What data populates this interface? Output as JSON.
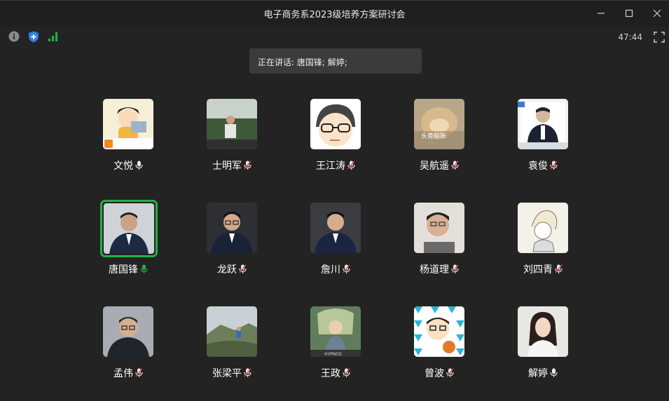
{
  "window": {
    "title": "电子商务系2023级培养方案研讨会",
    "controls": [
      "minimize-icon",
      "maximize-icon",
      "close-icon"
    ]
  },
  "toolbar": {
    "icons": [
      "info-icon",
      "security-shield-icon",
      "signal-strength-icon",
      "fullscreen-icon"
    ],
    "timer": "47:44"
  },
  "speaking_banner": "正在讲话: 唐国锋; 解婷;",
  "colors": {
    "background": "#232323",
    "active_border": "#22b14c",
    "mic_active": "#22b14c",
    "mic_muted": "#e03c3c"
  },
  "participants": [
    {
      "name": "文悦",
      "mic": "on",
      "avatar_caption": "自愿上班"
    },
    {
      "name": "士明军",
      "mic": "muted"
    },
    {
      "name": "王江涛",
      "mic": "muted"
    },
    {
      "name": "吴航遥",
      "mic": "muted",
      "avatar_caption": "头昏脑胀"
    },
    {
      "name": "袁俊",
      "mic": "muted"
    },
    {
      "name": "唐国锋",
      "mic": "speaking",
      "active": true
    },
    {
      "name": "龙跃",
      "mic": "muted"
    },
    {
      "name": "詹川",
      "mic": "muted"
    },
    {
      "name": "杨道理",
      "mic": "muted"
    },
    {
      "name": "刘四青",
      "mic": "muted"
    },
    {
      "name": "孟伟",
      "mic": "muted"
    },
    {
      "name": "张梁平",
      "mic": "muted"
    },
    {
      "name": "王政",
      "mic": "muted"
    },
    {
      "name": "曾波",
      "mic": "muted"
    },
    {
      "name": "解婷",
      "mic": "on"
    }
  ]
}
